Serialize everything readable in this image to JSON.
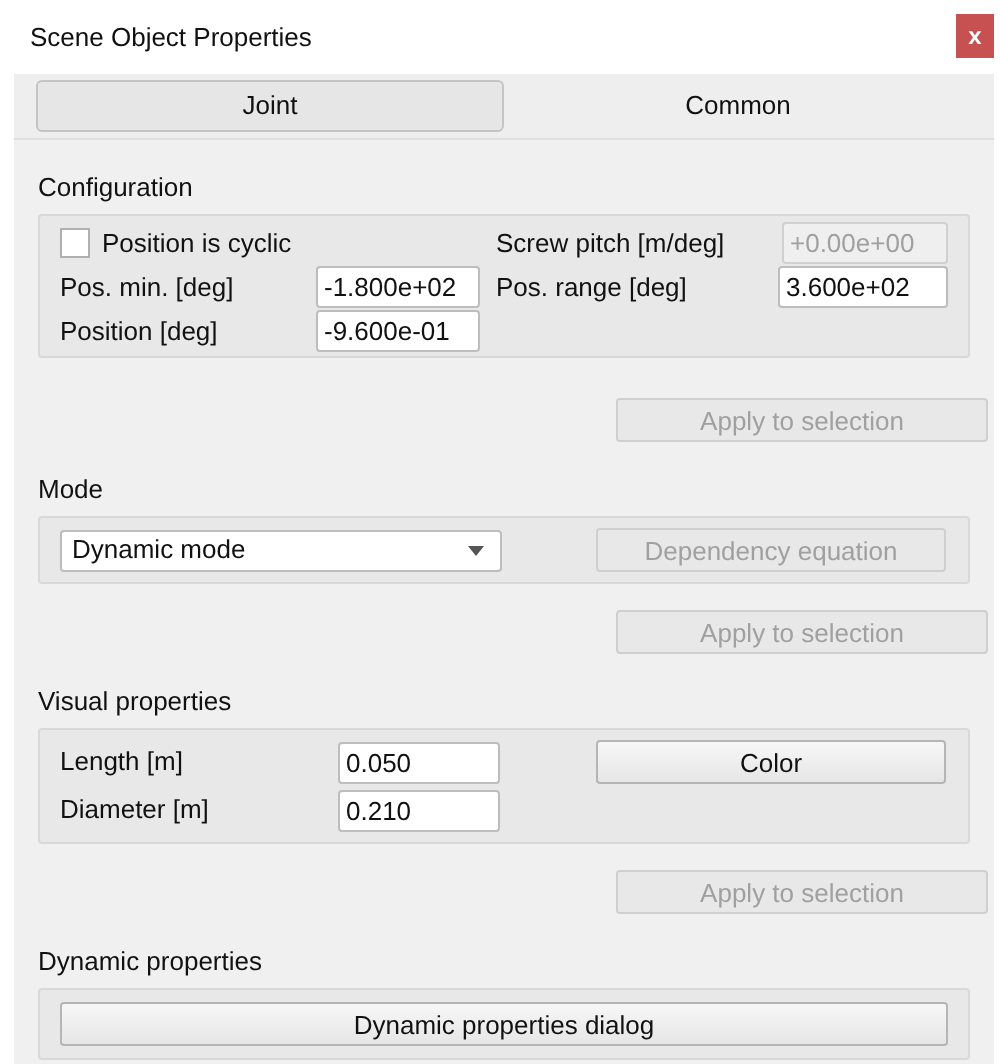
{
  "window": {
    "title": "Scene Object Properties",
    "close": "x"
  },
  "tabs": [
    {
      "label": "Joint",
      "selected": true
    },
    {
      "label": "Common",
      "selected": false
    }
  ],
  "configuration": {
    "title": "Configuration",
    "cyclic": {
      "label": "Position is cyclic",
      "checked": false
    },
    "screw_pitch": {
      "label": "Screw pitch [m/deg]",
      "value": "+0.00e+00",
      "disabled": true
    },
    "pos_min": {
      "label": "Pos. min. [deg]",
      "value": "-1.800e+02",
      "disabled": false
    },
    "pos_range": {
      "label": "Pos. range [deg]",
      "value": "3.600e+02",
      "disabled": false
    },
    "position": {
      "label": "Position [deg]",
      "value": "-9.600e-01",
      "disabled": false
    },
    "apply": {
      "label": "Apply to selection",
      "disabled": true
    }
  },
  "mode": {
    "title": "Mode",
    "dropdown": {
      "value": "Dynamic mode"
    },
    "dependency": {
      "label": "Dependency equation",
      "disabled": true
    },
    "apply": {
      "label": "Apply to selection",
      "disabled": true
    }
  },
  "visual": {
    "title": "Visual properties",
    "length": {
      "label": "Length [m]",
      "value": "0.050",
      "disabled": false
    },
    "diameter": {
      "label": "Diameter [m]",
      "value": "0.210",
      "disabled": false
    },
    "color": {
      "label": "Color",
      "disabled": false
    },
    "apply": {
      "label": "Apply to selection",
      "disabled": true
    }
  },
  "dynamic": {
    "title": "Dynamic properties",
    "dialog": {
      "label": "Dynamic properties dialog",
      "disabled": false
    }
  }
}
